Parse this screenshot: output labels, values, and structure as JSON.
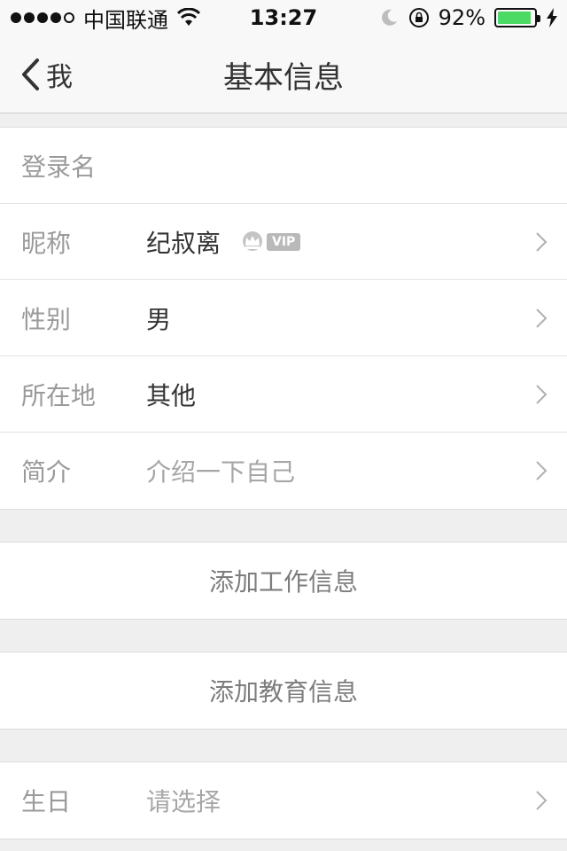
{
  "status_bar": {
    "carrier": "中国联通",
    "time": "13:27",
    "battery_percent_text": "92%",
    "battery_level": 0.92,
    "battery_color": "#4cd964",
    "icons": [
      "signal-dots",
      "wifi-icon",
      "moon-icon",
      "rotation-lock-icon",
      "battery-icon",
      "charging-bolt-icon"
    ]
  },
  "nav": {
    "back_label": "我",
    "title": "基本信息"
  },
  "profile_rows": [
    {
      "label": "登录名",
      "value": "",
      "has_chevron": false
    },
    {
      "label": "昵称",
      "value": "纪叔离",
      "vip": "VIP",
      "has_chevron": true
    },
    {
      "label": "性别",
      "value": "男",
      "has_chevron": true
    },
    {
      "label": "所在地",
      "value": "其他",
      "has_chevron": true
    },
    {
      "label": "简介",
      "value": "介绍一下自己",
      "placeholder": true,
      "has_chevron": true
    }
  ],
  "actions": {
    "add_work": "添加工作信息",
    "add_education": "添加教育信息"
  },
  "birthday_row": {
    "label": "生日",
    "value": "请选择",
    "placeholder": true
  }
}
